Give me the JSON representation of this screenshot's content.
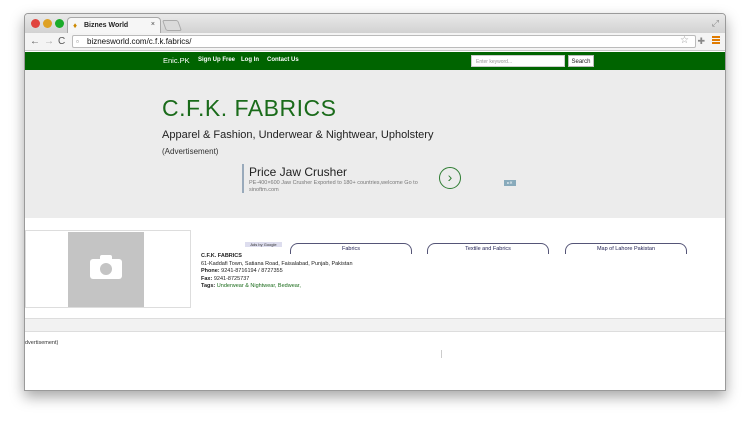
{
  "browser": {
    "tab_title": "Biznes World",
    "url": "biznesworld.com/c.f.k.fabrics/",
    "close": "×"
  },
  "nav": {
    "brand": "Enic.PK",
    "links": [
      "Sign Up Free",
      "Log In",
      "Contact Us"
    ],
    "search_placeholder": "Enter keyword...",
    "search_button": "Search"
  },
  "hero": {
    "title": "C.F.K. FABRICS",
    "subtitle": "Apparel & Fashion, Underwear & Nightwear, Upholstery",
    "advertisement": "(Advertisement)"
  },
  "ad": {
    "title": "Price Jaw Crusher",
    "description": "PE-400×600 Jaw Crusher Exported to 180+ countries,welcome Go to sinoftm.com",
    "go": "›"
  },
  "ads_by_google": "Ads by Google",
  "pills": [
    "Fabrics",
    "Textile and Fabrics",
    "Map of Lahore Pakistan"
  ],
  "listing": {
    "name": "C.F.K. FABRICS",
    "address": "61-Kaddafi Town, Satiana Road, Faisalabad, Punjab, Pakistan",
    "phone_label": "Phone:",
    "phone": "9241-8716194 / 8727355",
    "fax_label": "Fax:",
    "fax": "9241-8725737",
    "tags_label": "Tags:",
    "tags": "Underwear & Nightwear, Bedwear,"
  },
  "footer_advertisement": "dvertisement)"
}
